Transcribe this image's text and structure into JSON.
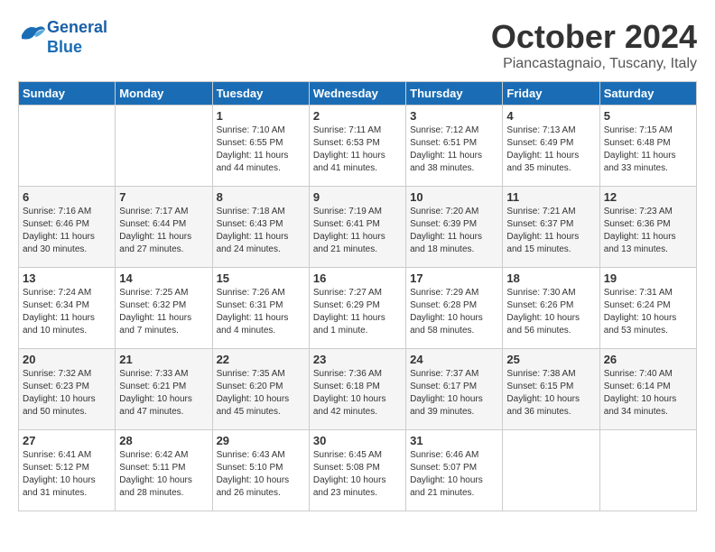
{
  "header": {
    "logo_line1": "General",
    "logo_line2": "Blue",
    "month": "October 2024",
    "location": "Piancastagnaio, Tuscany, Italy"
  },
  "days_of_week": [
    "Sunday",
    "Monday",
    "Tuesday",
    "Wednesday",
    "Thursday",
    "Friday",
    "Saturday"
  ],
  "weeks": [
    [
      {
        "num": "",
        "info": ""
      },
      {
        "num": "",
        "info": ""
      },
      {
        "num": "1",
        "info": "Sunrise: 7:10 AM\nSunset: 6:55 PM\nDaylight: 11 hours\nand 44 minutes."
      },
      {
        "num": "2",
        "info": "Sunrise: 7:11 AM\nSunset: 6:53 PM\nDaylight: 11 hours\nand 41 minutes."
      },
      {
        "num": "3",
        "info": "Sunrise: 7:12 AM\nSunset: 6:51 PM\nDaylight: 11 hours\nand 38 minutes."
      },
      {
        "num": "4",
        "info": "Sunrise: 7:13 AM\nSunset: 6:49 PM\nDaylight: 11 hours\nand 35 minutes."
      },
      {
        "num": "5",
        "info": "Sunrise: 7:15 AM\nSunset: 6:48 PM\nDaylight: 11 hours\nand 33 minutes."
      }
    ],
    [
      {
        "num": "6",
        "info": "Sunrise: 7:16 AM\nSunset: 6:46 PM\nDaylight: 11 hours\nand 30 minutes."
      },
      {
        "num": "7",
        "info": "Sunrise: 7:17 AM\nSunset: 6:44 PM\nDaylight: 11 hours\nand 27 minutes."
      },
      {
        "num": "8",
        "info": "Sunrise: 7:18 AM\nSunset: 6:43 PM\nDaylight: 11 hours\nand 24 minutes."
      },
      {
        "num": "9",
        "info": "Sunrise: 7:19 AM\nSunset: 6:41 PM\nDaylight: 11 hours\nand 21 minutes."
      },
      {
        "num": "10",
        "info": "Sunrise: 7:20 AM\nSunset: 6:39 PM\nDaylight: 11 hours\nand 18 minutes."
      },
      {
        "num": "11",
        "info": "Sunrise: 7:21 AM\nSunset: 6:37 PM\nDaylight: 11 hours\nand 15 minutes."
      },
      {
        "num": "12",
        "info": "Sunrise: 7:23 AM\nSunset: 6:36 PM\nDaylight: 11 hours\nand 13 minutes."
      }
    ],
    [
      {
        "num": "13",
        "info": "Sunrise: 7:24 AM\nSunset: 6:34 PM\nDaylight: 11 hours\nand 10 minutes."
      },
      {
        "num": "14",
        "info": "Sunrise: 7:25 AM\nSunset: 6:32 PM\nDaylight: 11 hours\nand 7 minutes."
      },
      {
        "num": "15",
        "info": "Sunrise: 7:26 AM\nSunset: 6:31 PM\nDaylight: 11 hours\nand 4 minutes."
      },
      {
        "num": "16",
        "info": "Sunrise: 7:27 AM\nSunset: 6:29 PM\nDaylight: 11 hours\nand 1 minute."
      },
      {
        "num": "17",
        "info": "Sunrise: 7:29 AM\nSunset: 6:28 PM\nDaylight: 10 hours\nand 58 minutes."
      },
      {
        "num": "18",
        "info": "Sunrise: 7:30 AM\nSunset: 6:26 PM\nDaylight: 10 hours\nand 56 minutes."
      },
      {
        "num": "19",
        "info": "Sunrise: 7:31 AM\nSunset: 6:24 PM\nDaylight: 10 hours\nand 53 minutes."
      }
    ],
    [
      {
        "num": "20",
        "info": "Sunrise: 7:32 AM\nSunset: 6:23 PM\nDaylight: 10 hours\nand 50 minutes."
      },
      {
        "num": "21",
        "info": "Sunrise: 7:33 AM\nSunset: 6:21 PM\nDaylight: 10 hours\nand 47 minutes."
      },
      {
        "num": "22",
        "info": "Sunrise: 7:35 AM\nSunset: 6:20 PM\nDaylight: 10 hours\nand 45 minutes."
      },
      {
        "num": "23",
        "info": "Sunrise: 7:36 AM\nSunset: 6:18 PM\nDaylight: 10 hours\nand 42 minutes."
      },
      {
        "num": "24",
        "info": "Sunrise: 7:37 AM\nSunset: 6:17 PM\nDaylight: 10 hours\nand 39 minutes."
      },
      {
        "num": "25",
        "info": "Sunrise: 7:38 AM\nSunset: 6:15 PM\nDaylight: 10 hours\nand 36 minutes."
      },
      {
        "num": "26",
        "info": "Sunrise: 7:40 AM\nSunset: 6:14 PM\nDaylight: 10 hours\nand 34 minutes."
      }
    ],
    [
      {
        "num": "27",
        "info": "Sunrise: 6:41 AM\nSunset: 5:12 PM\nDaylight: 10 hours\nand 31 minutes."
      },
      {
        "num": "28",
        "info": "Sunrise: 6:42 AM\nSunset: 5:11 PM\nDaylight: 10 hours\nand 28 minutes."
      },
      {
        "num": "29",
        "info": "Sunrise: 6:43 AM\nSunset: 5:10 PM\nDaylight: 10 hours\nand 26 minutes."
      },
      {
        "num": "30",
        "info": "Sunrise: 6:45 AM\nSunset: 5:08 PM\nDaylight: 10 hours\nand 23 minutes."
      },
      {
        "num": "31",
        "info": "Sunrise: 6:46 AM\nSunset: 5:07 PM\nDaylight: 10 hours\nand 21 minutes."
      },
      {
        "num": "",
        "info": ""
      },
      {
        "num": "",
        "info": ""
      }
    ]
  ]
}
